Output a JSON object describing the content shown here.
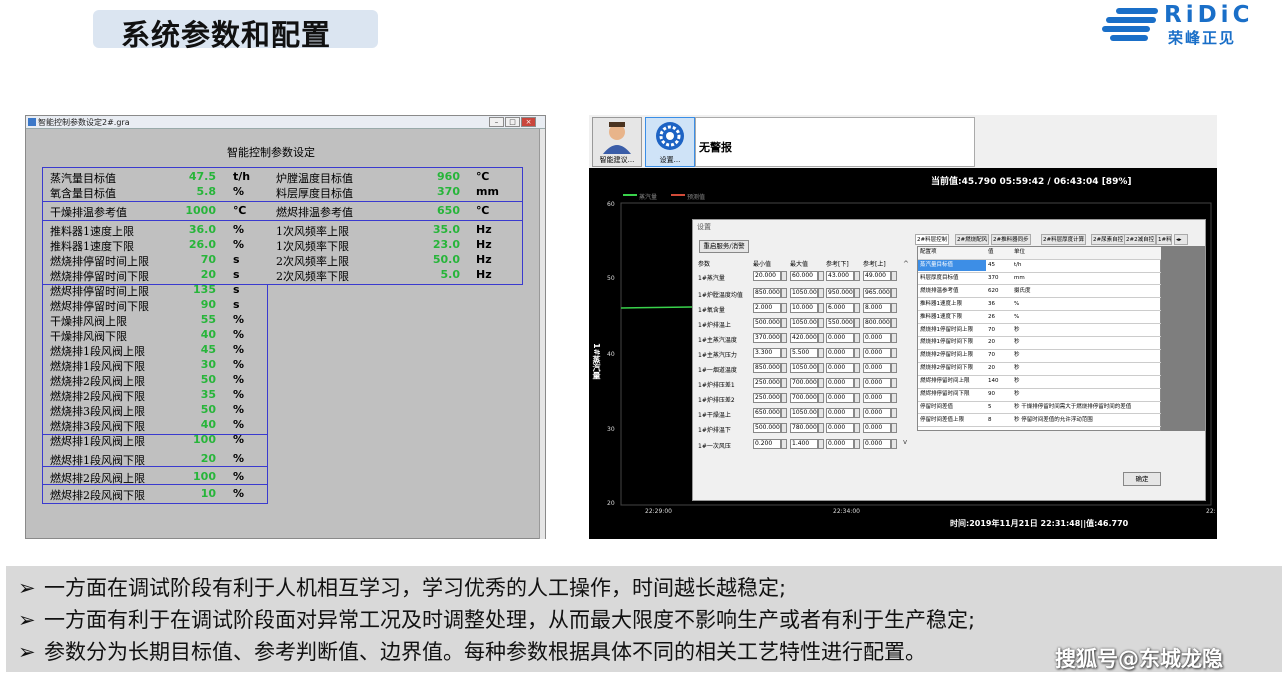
{
  "slide": {
    "title": "系统参数和配置",
    "logo_en": "RiDiC",
    "logo_cn": "荣峰正见",
    "watermark": "搜狐号@东城龙隐"
  },
  "left_window": {
    "titlebar": "智能控制参数设定2#.gra",
    "heading": "智能控制参数设定",
    "params_left": [
      {
        "label": "蒸汽量目标值",
        "value": "47.5",
        "unit": "t/h"
      },
      {
        "label": "氧含量目标值",
        "value": "5.8",
        "unit": "%"
      },
      {
        "label": "干燥排温参考值",
        "value": "1000",
        "unit": "℃"
      },
      {
        "label": "推料器1速度上限",
        "value": "36.0",
        "unit": "%"
      },
      {
        "label": "推料器1速度下限",
        "value": "26.0",
        "unit": "%"
      },
      {
        "label": "燃烧排停留时间上限",
        "value": "70",
        "unit": "s"
      },
      {
        "label": "燃烧排停留时间下限",
        "value": "20",
        "unit": "s"
      },
      {
        "label": "燃烬排停留时间上限",
        "value": "135",
        "unit": "s"
      },
      {
        "label": "燃烬排停留时间下限",
        "value": "90",
        "unit": "s"
      },
      {
        "label": "干燥排风阀上限",
        "value": "55",
        "unit": "%"
      },
      {
        "label": "干燥排风阀下限",
        "value": "40",
        "unit": "%"
      },
      {
        "label": "燃烧排1段风阀上限",
        "value": "45",
        "unit": "%"
      },
      {
        "label": "燃烧排1段风阀下限",
        "value": "30",
        "unit": "%"
      },
      {
        "label": "燃烧排2段风阀上限",
        "value": "50",
        "unit": "%"
      },
      {
        "label": "燃烧排2段风阀下限",
        "value": "35",
        "unit": "%"
      },
      {
        "label": "燃烧排3段风阀上限",
        "value": "50",
        "unit": "%"
      },
      {
        "label": "燃烧排3段风阀下限",
        "value": "40",
        "unit": "%"
      },
      {
        "label": "燃烬排1段风阀上限",
        "value": "100",
        "unit": "%"
      },
      {
        "label": "燃烬排1段风阀下限",
        "value": "20",
        "unit": "%"
      },
      {
        "label": "燃烬排2段风阀上限",
        "value": "100",
        "unit": "%"
      },
      {
        "label": "燃烬排2段风阀下限",
        "value": "10",
        "unit": "%"
      }
    ],
    "params_right": [
      {
        "label": "炉膛温度目标值",
        "value": "960",
        "unit": "℃"
      },
      {
        "label": "料层厚度目标值",
        "value": "370",
        "unit": "mm"
      },
      {
        "label": "燃烬排温参考值",
        "value": "650",
        "unit": "℃"
      },
      {
        "label": "1次风频率上限",
        "value": "35.0",
        "unit": "Hz"
      },
      {
        "label": "1次风频率下限",
        "value": "23.0",
        "unit": "Hz"
      },
      {
        "label": "2次风频率上限",
        "value": "50.0",
        "unit": "Hz"
      },
      {
        "label": "2次风频率下限",
        "value": "5.0",
        "unit": "Hz"
      }
    ]
  },
  "right_window": {
    "buttons": [
      "智能建议...",
      "设置..."
    ],
    "alarm": "无警报",
    "status": "当前值:45.790    05:59:42 / 06:43:04  [89%]",
    "time_readout": "时间:2019年11月21日 22:31:48||值:46.770",
    "y_axis_label": "1#蒸汽量",
    "legend": [
      "蒸汽量",
      "预测值"
    ],
    "y_ticks": [
      "60",
      "50",
      "40",
      "30",
      "20"
    ],
    "x_ticks": [
      "22:29:00",
      "22:34:00",
      "22:39:00"
    ],
    "dialog": {
      "title": "设置",
      "restart_button": "重启服务/消警",
      "headers": [
        "参数",
        "最小值",
        "最大值",
        "参考[下]",
        "参考[上]"
      ],
      "rows": [
        {
          "name": "1#蒸汽量",
          "v": [
            "20.000",
            "60.000",
            "43.000",
            "49.000"
          ]
        },
        {
          "name": "1#炉膛温度均值",
          "v": [
            "850.000",
            "1050.00",
            "950.000",
            "965.000"
          ]
        },
        {
          "name": "1#氧含量",
          "v": [
            "2.000",
            "10.000",
            "6.000",
            "8.000"
          ]
        },
        {
          "name": "1#炉排温上",
          "v": [
            "500.000",
            "1050.00",
            "550.000",
            "800.000"
          ]
        },
        {
          "name": "1#主蒸汽温度",
          "v": [
            "370.000",
            "420.000",
            "0.000",
            "0.000"
          ]
        },
        {
          "name": "1#主蒸汽压力",
          "v": [
            "3.300",
            "5.500",
            "0.000",
            "0.000"
          ]
        },
        {
          "name": "1#一烟道温度",
          "v": [
            "850.000",
            "1050.00",
            "0.000",
            "0.000"
          ]
        },
        {
          "name": "1#炉排压差1",
          "v": [
            "250.000",
            "700.000",
            "0.000",
            "0.000"
          ]
        },
        {
          "name": "1#炉排压差2",
          "v": [
            "250.000",
            "700.000",
            "0.000",
            "0.000"
          ]
        },
        {
          "name": "1#干燥温上",
          "v": [
            "650.000",
            "1050.00",
            "0.000",
            "0.000"
          ]
        },
        {
          "name": "1#炉排温下",
          "v": [
            "500.000",
            "780.000",
            "0.000",
            "0.000"
          ]
        },
        {
          "name": "1#一次风压",
          "v": [
            "0.200",
            "1.400",
            "0.000",
            "0.000"
          ]
        }
      ],
      "tabs": [
        "2#料层控制",
        "2#燃烧配风",
        "2#推料器同步",
        "2#料层厚度计算",
        "2#尿素自控",
        "2#2减自控",
        "1#料"
      ],
      "config_headers": [
        "配置项",
        "值",
        "单位"
      ],
      "config_rows": [
        {
          "item": "蒸汽量目标值",
          "value": "45",
          "unit": "t/h"
        },
        {
          "item": "料层厚度目标值",
          "value": "370",
          "unit": "mm"
        },
        {
          "item": "燃烧排温参考值",
          "value": "620",
          "unit": "摄氏度"
        },
        {
          "item": "推料器1速度上限",
          "value": "36",
          "unit": "%"
        },
        {
          "item": "推料器1速度下限",
          "value": "26",
          "unit": "%"
        },
        {
          "item": "燃烧排1停留时间上限",
          "value": "70",
          "unit": "秒"
        },
        {
          "item": "燃烧排1停留时间下限",
          "value": "20",
          "unit": "秒"
        },
        {
          "item": "燃烧排2停留时间上限",
          "value": "70",
          "unit": "秒"
        },
        {
          "item": "燃烧排2停留时间下限",
          "value": "20",
          "unit": "秒"
        },
        {
          "item": "燃烬排停留时间上限",
          "value": "140",
          "unit": "秒"
        },
        {
          "item": "燃烬排停留时间下限",
          "value": "90",
          "unit": "秒"
        },
        {
          "item": "停留时间差值",
          "value": "5",
          "unit": "秒  干燥排停留时间需大于燃烧排停留时间的差值"
        },
        {
          "item": "停留时间差值上限",
          "value": "8",
          "unit": "秒  停留时间差值的允许浮动范围"
        }
      ],
      "ok_button": "确定"
    }
  },
  "bullets": [
    "一方面在调试阶段有利于人机相互学习，学习优秀的人工操作，时间越长越稳定;",
    "一方面有利于在调试阶段面对异常工况及时调整处理，从而最大限度不影响生产或者有利于生产稳定;",
    "参数分为长期目标值、参考判断值、边界值。每种参数根据具体不同的相关工艺特性进行配置。"
  ],
  "bullet_mark": "➢",
  "colors": {
    "accent": "#1a6fc8",
    "value_green": "#27b53a",
    "grid_blue": "#3a3acf"
  }
}
